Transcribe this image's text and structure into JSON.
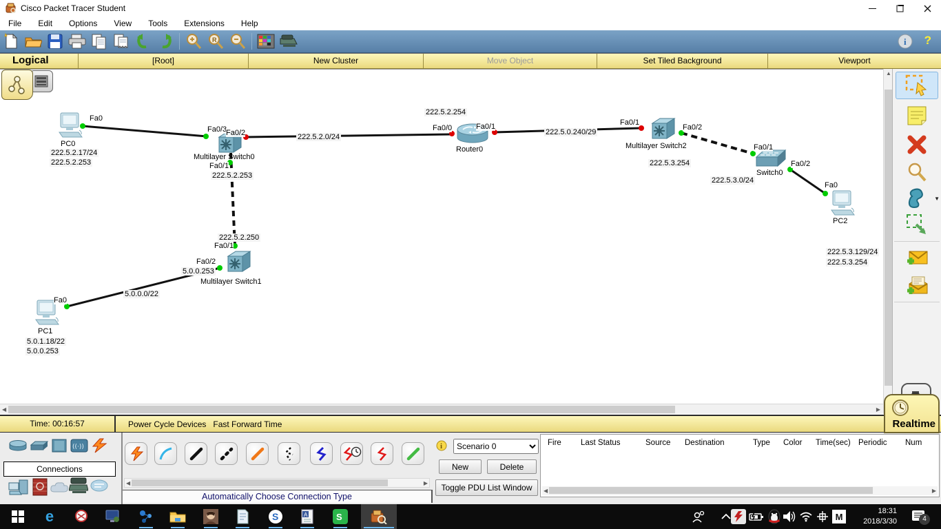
{
  "window": {
    "title": "Cisco Packet Tracer Student"
  },
  "menu": {
    "file": "File",
    "edit": "Edit",
    "options": "Options",
    "view": "View",
    "tools": "Tools",
    "extensions": "Extensions",
    "help": "Help"
  },
  "toolbar": {
    "help": "?"
  },
  "modebar": {
    "logical": "Logical",
    "root": "[Root]",
    "new_cluster": "New Cluster",
    "move_object": "Move Object",
    "set_tiled_background": "Set Tiled Background",
    "viewport": "Viewport"
  },
  "canvas": {
    "pc0": {
      "name": "PC0",
      "port": "Fa0",
      "ip": "222.5.2.17/24",
      "gateway": "222.5.2.253"
    },
    "mls0": {
      "name": "Multilayer Switch0",
      "port_fa03": "Fa0/3",
      "port_fa02": "Fa0/2",
      "port_fa01": "Fa0/1",
      "ip": "222.5.2.253"
    },
    "router0": {
      "name": "Router0",
      "ip": "222.5.2.254",
      "port_fa00": "Fa0/0",
      "port_fa01": "Fa0/1"
    },
    "mls2": {
      "name": "Multilayer Switch2",
      "port_fa01": "Fa0/1",
      "port_fa02": "Fa0/2",
      "ip": "222.5.3.254"
    },
    "switch0": {
      "name": "Switch0",
      "port_fa01": "Fa0/1",
      "port_fa02": "Fa0/2"
    },
    "pc2": {
      "name": "PC2",
      "port": "Fa0",
      "ip": "222.5.3.129/24",
      "gateway": "222.5.3.254"
    },
    "mls1": {
      "name": "Multilayer Switch1",
      "uplink_ip": "222.5.2.250",
      "port_fa01": "Fa0/1",
      "port_fa02": "Fa0/2",
      "ip": "5.0.0.253"
    },
    "pc1": {
      "name": "PC1",
      "port": "Fa0",
      "ip": "5.0.1.18/22",
      "gateway": "5.0.0.253"
    },
    "net_2": "222.5.2.0/24",
    "net_240": "222.5.0.240/29",
    "net_3": "222.5.3.0/24",
    "net_5": "5.0.0.0/22",
    "link_colors": {
      "up": "#00cc00",
      "down": "#dd0000"
    }
  },
  "timebar": {
    "time": "Time: 00:16:57",
    "power_cycle": "Power Cycle Devices",
    "fast_forward": "Fast Forward Time"
  },
  "mode_tabs": {
    "realtime": "Realtime"
  },
  "palette": {
    "category": "Connections"
  },
  "connections": {
    "auto_choose": "Automatically Choose Connection Type"
  },
  "scenario": {
    "selected": "Scenario 0",
    "new_button": "New",
    "delete_button": "Delete",
    "toggle_button": "Toggle PDU List Window"
  },
  "pdu_list": {
    "headers": [
      "Fire",
      "Last Status",
      "Source",
      "Destination",
      "Type",
      "Color",
      "Time(sec)",
      "Periodic",
      "Num"
    ]
  },
  "taskbar": {
    "time": "18:31",
    "date": "2018/3/30",
    "notification_count": "4",
    "tray_m": "M"
  }
}
